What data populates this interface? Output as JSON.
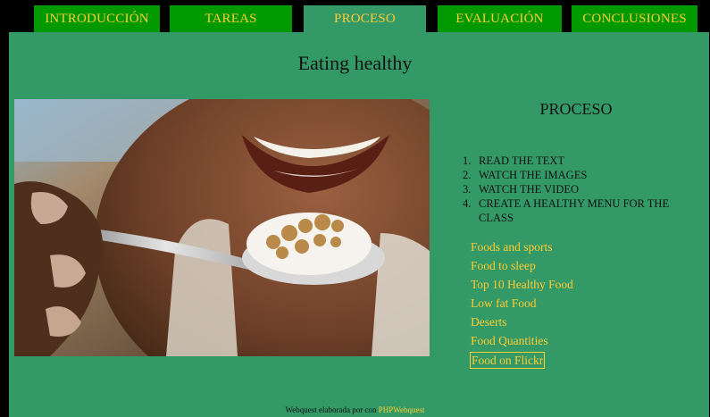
{
  "nav": {
    "tabs": [
      {
        "label": "INTRODUCCIÓN"
      },
      {
        "label": "TAREAS"
      },
      {
        "label": "PROCESO"
      },
      {
        "label": "EVALUACIÓN"
      },
      {
        "label": "CONCLUSIONES"
      }
    ]
  },
  "page": {
    "title": "Eating healthy",
    "section_heading": "PROCESO"
  },
  "steps": [
    {
      "num": "1.",
      "text": "READ THE TEXT"
    },
    {
      "num": "2.",
      "text": "WATCH THE IMAGES"
    },
    {
      "num": "3.",
      "text": "WATCH THE VIDEO"
    },
    {
      "num": "4.",
      "text": "CREATE A HEALTHY MENU FOR THE CLASS"
    }
  ],
  "links": [
    {
      "label": "Foods and sports"
    },
    {
      "label": "Food to sleep"
    },
    {
      "label": "Top 10 Healthy Food"
    },
    {
      "label": "Low fat Food"
    },
    {
      "label": "Deserts"
    },
    {
      "label": "Food Quantities"
    },
    {
      "label": "Food on Flickr"
    }
  ],
  "footer": {
    "text": "Webquest elaborada por con",
    "link": "PHPWebquest"
  },
  "colors": {
    "page_bg": "#339966",
    "tab_bg": "#009900",
    "link": "#ffcc33",
    "frame": "#000000"
  }
}
